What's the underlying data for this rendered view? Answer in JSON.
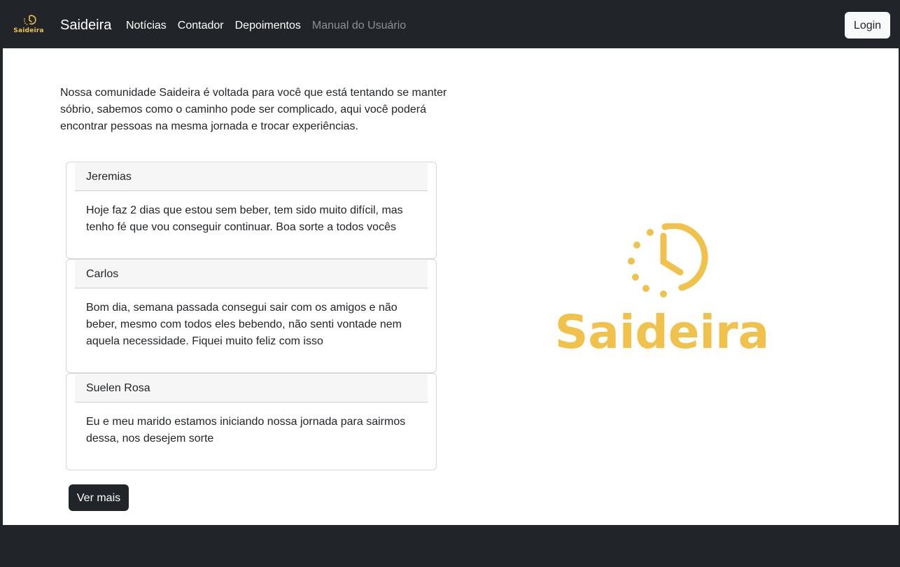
{
  "navbar": {
    "logo_text": "Saideira",
    "brand": "Saideira",
    "links": [
      "Notícias",
      "Contador",
      "Depoimentos",
      "Manual do Usuário"
    ],
    "login_label": "Login"
  },
  "main": {
    "intro": "Nossa comunidade Saideira é voltada para você que está tentando se manter sóbrio, sabemos como o caminho pode ser complicado, aqui você poderá encontrar pessoas na mesma jornada e trocar experiências.",
    "testimonials": [
      {
        "name": "Jeremias",
        "text": "Hoje faz 2 dias que estou sem beber, tem sido muito difícil, mas tenho fé que vou conseguir continuar. Boa sorte a todos vocês"
      },
      {
        "name": "Carlos",
        "text": "Bom dia, semana passada consegui sair com os amigos e não beber, mesmo com todos eles bebendo, não senti vontade nem aquela necessidade. Fiquei muito feliz com isso"
      },
      {
        "name": "Suelen Rosa",
        "text": "Eu e meu marido estamos iniciando nossa jornada para sairmos dessa, nos desejem sorte"
      }
    ],
    "more_label": "Ver mais",
    "logo_text": "Saideira"
  },
  "colors": {
    "dark": "#212529",
    "brand_yellow": "#f0c24b",
    "muted_link": "#8c9196"
  },
  "icons": {
    "nav_logo": "clock-logo-icon",
    "hero_logo": "clock-logo-icon"
  }
}
